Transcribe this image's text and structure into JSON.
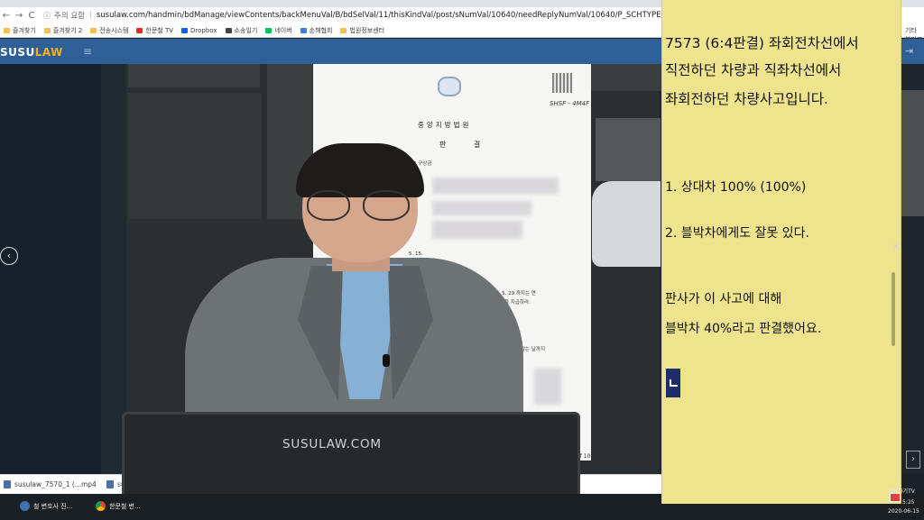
{
  "browser": {
    "url_security_label": "주의 요함",
    "url": "susulaw.com/handmin/bdManage/viewContents/backMenuVal/B/bdSelVal/11/thisKindVal/post/sNumVal/10640/needReplyNumVal/10640/P_SCHTYPE/sNum/P_SCHVAL/7573/lastPage",
    "nav": {
      "back": "←",
      "forward": "→",
      "reload": "C"
    },
    "bookmarks": [
      {
        "label": "즐겨찾기",
        "icon": "folder-icon",
        "color": "#f2c14e"
      },
      {
        "label": "즐겨찾기 2",
        "icon": "folder-icon",
        "color": "#f2c14e"
      },
      {
        "label": "전송시스템",
        "icon": "folder-icon",
        "color": "#f2c14e"
      },
      {
        "label": "한문철 TV",
        "icon": "youtube-icon",
        "color": "#e52d27"
      },
      {
        "label": "Dropbox",
        "icon": "dropbox-icon",
        "color": "#0061fe"
      },
      {
        "label": "소송일기",
        "icon": "globe-icon",
        "color": "#444444"
      },
      {
        "label": "네이버",
        "icon": "naver-icon",
        "color": "#03c75a"
      },
      {
        "label": "손해협회",
        "icon": "site-icon",
        "color": "#3b7dd8"
      },
      {
        "label": "법원정보센터",
        "icon": "folder-icon",
        "color": "#f2c14e"
      }
    ],
    "bookmarks_more": "기타 북마크"
  },
  "site": {
    "logo_main": "SUSU",
    "logo_accent": "LAW",
    "menu_icon": "hamburger-icon",
    "accent_color": "#2e5f96",
    "logo_accent_color": "#f0b020"
  },
  "document": {
    "signature": "SHSF - 4M4F",
    "court": "중앙지방법원",
    "title": "판     결",
    "line_case": "503  구상금",
    "line_date1": "5. 15.",
    "line_date2": "29.",
    "line_heading": "문",
    "line_order1": "019. 11. 9.부터 2020. 5. 29.까지는 연",
    "line_order2": "계산한 돈을 지급하라.",
    "line_order3": "갚는 날까지",
    "line_order4": "계산한 돈을 지급",
    "page_indicator": "of 10"
  },
  "monitor_label": "SUSULAW.COM",
  "note": {
    "line1": "7573 (6:4판결) 좌회전차선에서",
    "line2": "직전하던 차량과 직좌차선에서",
    "line3": "좌회전하던 차량사고입니다.",
    "item1": "1. 상대차 100%  (100%)",
    "item2": "2. 블박차에게도 잘못 있다.",
    "line4": "판사가 이 사고에 대해",
    "line5": "블박차 40%라고 판결했어요.",
    "background_color": "#efe48e"
  },
  "downloads": [
    {
      "label": "susulaw_7570_1 (...mp4",
      "icon": "video-file-icon"
    },
    {
      "label": "su",
      "icon": "video-file-icon"
    }
  ],
  "taskbar": {
    "items": [
      {
        "label": "철 변호사 진...",
        "icon": "app-icon"
      },
      {
        "label": "한문철 변...",
        "icon": "chrome-icon"
      }
    ],
    "tray_label": "설정하기TV",
    "time": "5:25",
    "date": "2020-06-15"
  }
}
